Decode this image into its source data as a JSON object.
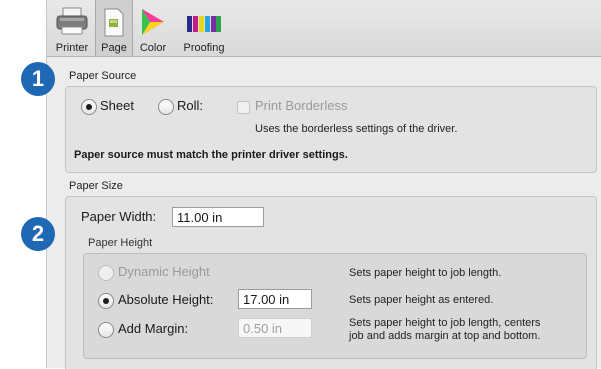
{
  "toolbar": {
    "items": [
      {
        "label": "Printer",
        "icon": "printer-icon"
      },
      {
        "label": "Page",
        "icon": "page-icon"
      },
      {
        "label": "Color",
        "icon": "color-icon"
      },
      {
        "label": "Proofing",
        "icon": "proofing-icon"
      }
    ],
    "selected": "Page"
  },
  "badges": {
    "one": "1",
    "two": "2",
    "color": "#1f68b3"
  },
  "paper_source": {
    "title": "Paper Source",
    "sheet_label": "Sheet",
    "roll_label": "Roll:",
    "selected": "Sheet",
    "borderless_label": "Print Borderless",
    "borderless_checked": false,
    "borderless_enabled": false,
    "borderless_note": "Uses the borderless settings of the driver.",
    "warning": "Paper source must match the printer driver settings."
  },
  "paper_size": {
    "title": "Paper Size",
    "width_label": "Paper Width:",
    "width_value": "11.00 in",
    "height_group_title": "Paper Height",
    "options": {
      "dynamic": {
        "label": "Dynamic Height",
        "desc": "Sets paper height to job length.",
        "enabled": false
      },
      "absolute": {
        "label": "Absolute Height:",
        "value": "17.00 in",
        "desc": "Sets paper height as entered.",
        "selected": true
      },
      "margin": {
        "label": "Add Margin:",
        "value": "0.50 in",
        "desc_line1": "Sets paper height to job length, centers",
        "desc_line2": "job and adds margin at top and bottom.",
        "enabled_field": false
      }
    }
  }
}
